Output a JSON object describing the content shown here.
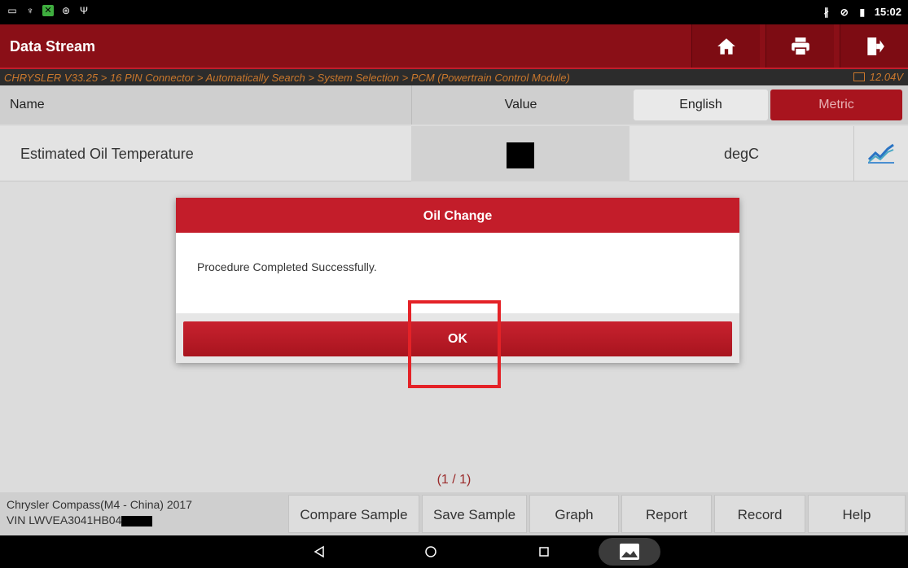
{
  "status_bar": {
    "time": "15:02"
  },
  "header": {
    "title": "Data Stream"
  },
  "breadcrumb": {
    "path": "CHRYSLER V33.25 > 16 PIN Connector > Automatically Search > System Selection > PCM (Powertrain Control Module)",
    "voltage": "12.04V"
  },
  "table": {
    "col_name": "Name",
    "col_value": "Value",
    "unit_english": "English",
    "unit_metric": "Metric",
    "rows": [
      {
        "name": "Estimated Oil Temperature",
        "unit": "degC"
      }
    ],
    "page": "(1 / 1)"
  },
  "dialog": {
    "title": "Oil Change",
    "message": "Procedure Completed Successfully.",
    "ok_label": "OK"
  },
  "vehicle": {
    "model": "Chrysler Compass(M4 - China) 2017",
    "vin": "VIN LWVEA3041HB04"
  },
  "toolbar": {
    "compare": "Compare Sample",
    "save": "Save Sample",
    "graph": "Graph",
    "report": "Report",
    "record": "Record",
    "help": "Help"
  },
  "colors": {
    "brand_red": "#8a0f17",
    "accent_red": "#c31d2a",
    "breadcrumb_orange": "#c9772c"
  }
}
